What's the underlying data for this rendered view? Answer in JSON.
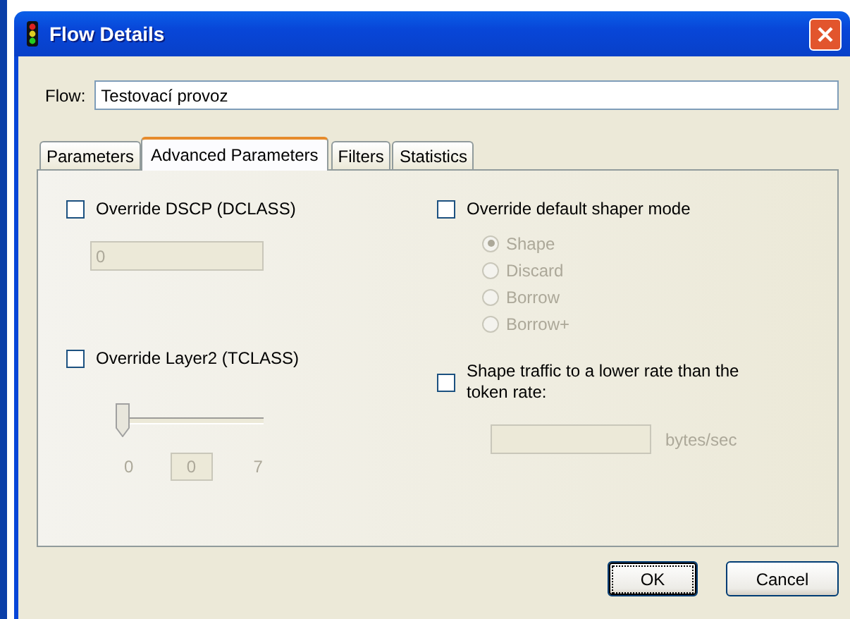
{
  "window": {
    "title": "Flow Details"
  },
  "flow": {
    "label": "Flow:",
    "value": "Testovací provoz"
  },
  "tabs": [
    {
      "label": "Parameters",
      "selected": false
    },
    {
      "label": "Advanced Parameters",
      "selected": true
    },
    {
      "label": "Filters",
      "selected": false
    },
    {
      "label": "Statistics",
      "selected": false
    }
  ],
  "dscp": {
    "label": "Override DSCP (DCLASS)",
    "checked": false,
    "value": "0",
    "disabled": true
  },
  "layer2": {
    "label": "Override Layer2 (TCLASS)",
    "checked": false,
    "level": 0,
    "min_label": "0",
    "max_label": "7",
    "value": "0",
    "disabled": true
  },
  "shaper": {
    "label": "Override default shaper mode",
    "checked": false,
    "disabled": true
  },
  "modes": [
    {
      "label": "Shape",
      "selected": true
    },
    {
      "label": "Discard",
      "selected": false
    },
    {
      "label": "Borrow",
      "selected": false
    },
    {
      "label": "Borrow+",
      "selected": false
    }
  ],
  "rate": {
    "label": "Shape traffic to a lower rate than the token rate:",
    "checked": false,
    "unit": "bytes/sec",
    "disabled": true
  },
  "buttons": [
    {
      "label": "OK",
      "default": true
    },
    {
      "label": "Cancel",
      "default": false
    }
  ]
}
